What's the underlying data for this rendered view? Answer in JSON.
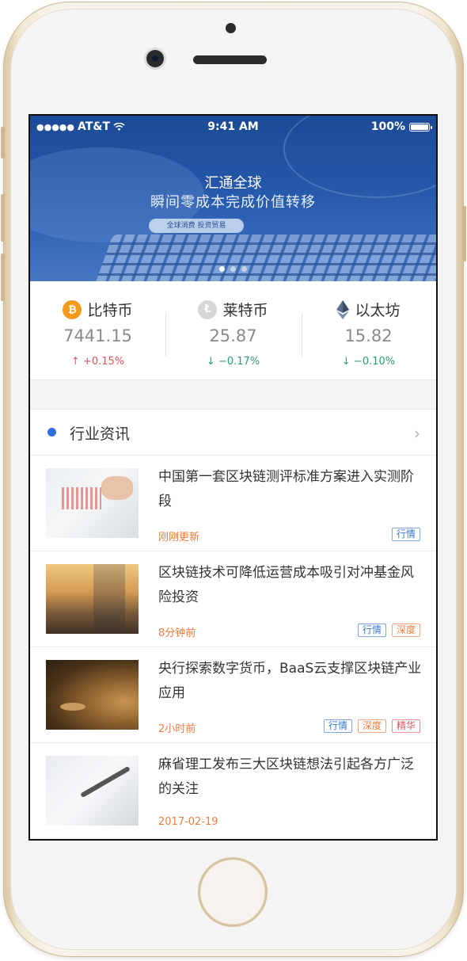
{
  "status_bar": {
    "signal": "●●●●●",
    "carrier": "AT&T",
    "wifi": "wifi-icon",
    "time": "9:41 AM",
    "battery": "100%"
  },
  "banner": {
    "title": "汇通全球",
    "subtitle": "瞬间零成本完成价值转移",
    "pill": "全球消费  投资贸易",
    "active_slide": 1,
    "slides": 3
  },
  "tickers": [
    {
      "name": "比特币",
      "icon": "bitcoin-icon",
      "glyph": "₿",
      "price": "7441.15",
      "arrow": "↑",
      "change": "+0.15%",
      "direction": "up"
    },
    {
      "name": "莱特币",
      "icon": "litecoin-icon",
      "glyph": "Ł",
      "price": "25.87",
      "arrow": "↓",
      "change": "−0.17%",
      "direction": "down"
    },
    {
      "name": "以太坊",
      "icon": "ethereum-icon",
      "glyph": "◆",
      "price": "15.82",
      "arrow": "↓",
      "change": "−0.10%",
      "direction": "down"
    }
  ],
  "colors": {
    "up": "#e0555d",
    "down": "#2f9b6e",
    "accent": "#2f6fe0",
    "time": "#f07c3c"
  },
  "news": {
    "section_title": "行业资讯",
    "chevron": "›",
    "items": [
      {
        "headline": "中国第一套区块链测评标准方案进入实测阶段",
        "time": "刚刚更新",
        "tags": [
          "行情"
        ]
      },
      {
        "headline": "区块链技术可降低运营成本吸引对冲基金风险投资",
        "time": "8分钟前",
        "tags": [
          "行情",
          "深度"
        ]
      },
      {
        "headline": "央行探索数字货币，BaaS云支撑区块链产业应用",
        "time": "2小时前",
        "tags": [
          "行情",
          "深度",
          "精华"
        ]
      },
      {
        "headline": "麻省理工发布三大区块链想法引起各方广泛的关注",
        "time": "2017-02-19",
        "tags": []
      }
    ]
  }
}
